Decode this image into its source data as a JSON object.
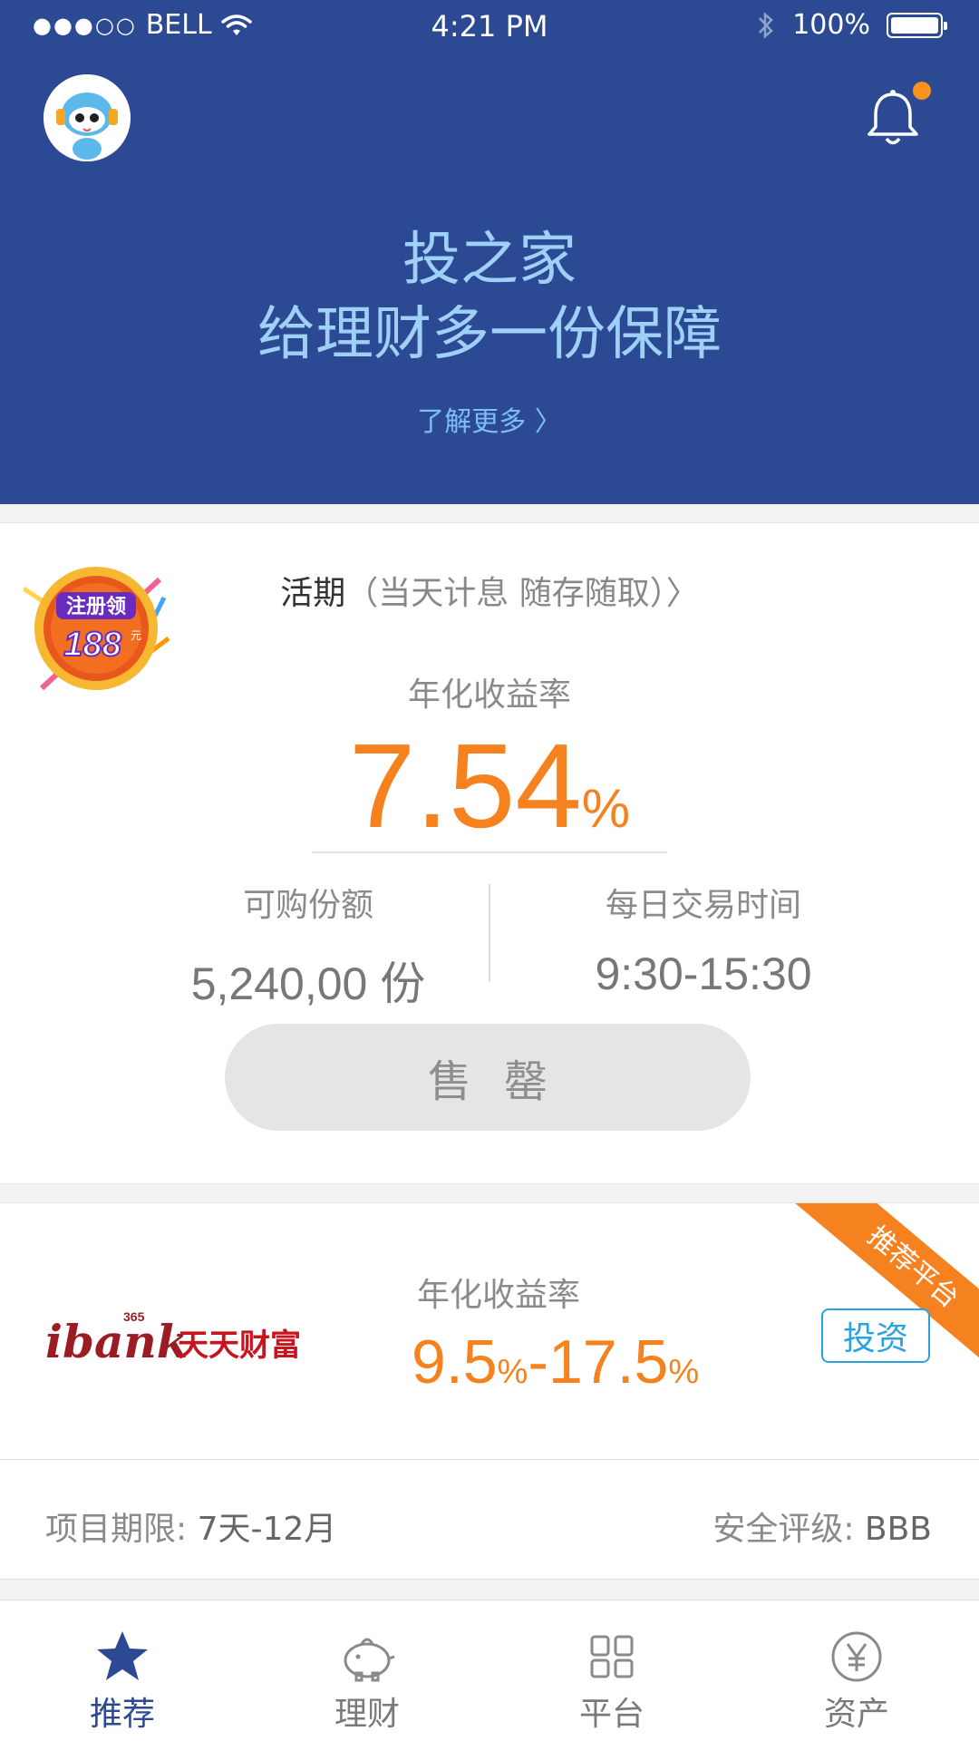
{
  "status_bar": {
    "signal": "●●●○○",
    "carrier": "BELL",
    "time": "4:21 PM",
    "battery": "100%"
  },
  "hero": {
    "title_line1": "投之家",
    "title_line2": "给理财多一份保障",
    "learn_more": "了解更多 〉"
  },
  "product1": {
    "badge_text_top": "注册领",
    "badge_amount": "188",
    "badge_unit": "元",
    "title": "活期",
    "subtitle": "（当天计息  随存随取）〉",
    "rate_label": "年化收益率",
    "rate_number": "7.54",
    "rate_unit": "%",
    "available_label": "可购份额",
    "available_value": "5,240,00 份",
    "trade_time_label": "每日交易时间",
    "trade_time_value": "9:30-15:30",
    "button_label": "售罄"
  },
  "product2": {
    "logo_prefix": "ibank",
    "logo_number": "365",
    "logo_name": "天天财富",
    "ribbon": "推荐平台",
    "rate_label": "年化收益率",
    "rate_low": "9.5",
    "rate_high": "17.5",
    "rate_unit": "%",
    "rate_dash": "-",
    "invest_button": "投资",
    "term_label": "项目期限: ",
    "term_value": "7天-12月",
    "rating_label": "安全评级: ",
    "rating_value": "BBB"
  },
  "tabbar": {
    "tabs": [
      {
        "label": "推荐",
        "icon": "star-icon",
        "active": true
      },
      {
        "label": "理财",
        "icon": "piggy-bank-icon",
        "active": false
      },
      {
        "label": "平台",
        "icon": "grid-icon",
        "active": false
      },
      {
        "label": "资产",
        "icon": "yuan-icon",
        "active": false
      }
    ]
  },
  "colors": {
    "header_blue": "#2c4a94",
    "accent_orange": "#f5821f",
    "hero_text": "#9fd0f7",
    "invest_blue": "#29a3e0"
  }
}
